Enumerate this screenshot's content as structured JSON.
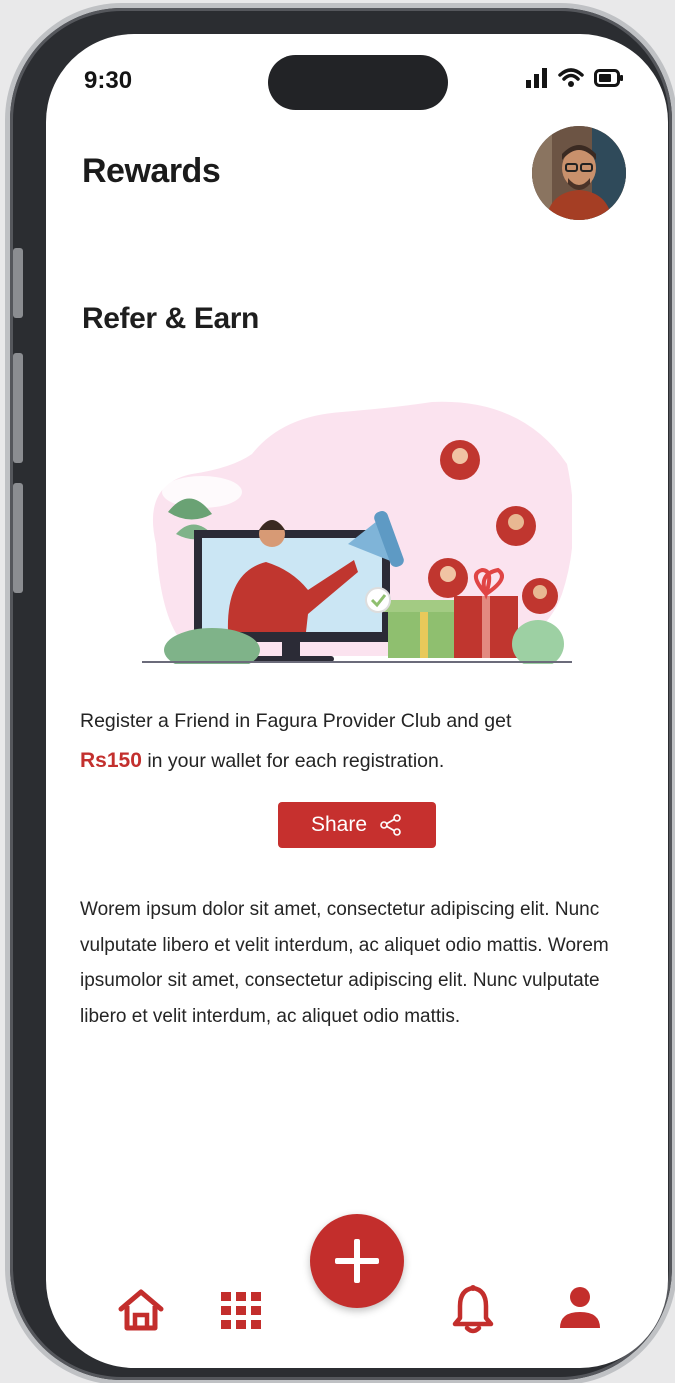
{
  "status_bar": {
    "time": "9:30"
  },
  "header": {
    "title": "Rewards"
  },
  "referral": {
    "title": "Refer & Earn",
    "description_line1": "Register a Friend in Fagura Provider Club and get",
    "amount": "Rs150",
    "description_line2": "in your wallet for each registration.",
    "share_label": "Share"
  },
  "body_text": "Worem ipsum dolor sit amet, consectetur adipiscing elit. Nunc vulputate libero et velit interdum, ac aliquet odio mattis. Worem ipsumolor sit amet, consectetur adipiscing elit. Nunc vulputate libero et velit interdum, ac aliquet odio mattis.",
  "bottom_nav": {
    "items": [
      {
        "icon": "home-icon"
      },
      {
        "icon": "grid-icon"
      },
      {
        "icon": "plus-icon"
      },
      {
        "icon": "bell-icon"
      },
      {
        "icon": "profile-icon"
      }
    ]
  },
  "colors": {
    "accent": "#c6302e",
    "text": "#242424",
    "background": "#ffffff"
  }
}
